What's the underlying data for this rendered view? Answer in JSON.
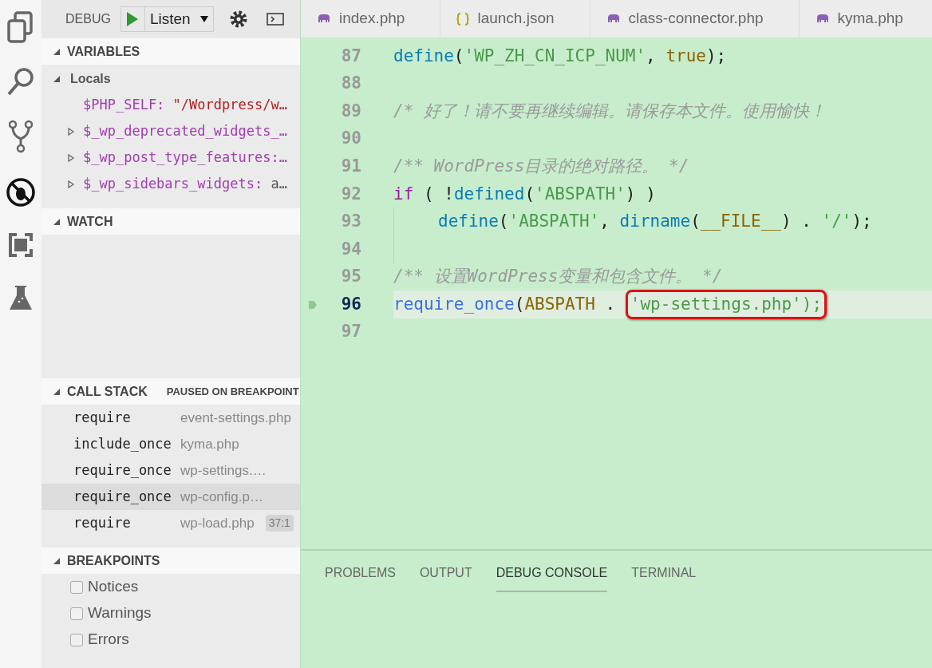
{
  "toolbar": {
    "label": "DEBUG",
    "config": "Listen"
  },
  "sections": [
    {
      "kind": "variables",
      "title": "VARIABLES",
      "expanded": true,
      "scope": {
        "label": "Locals",
        "expanded": true
      },
      "items": [
        {
          "name": "$PHP_SELF:",
          "value": " \"/Wordpress/w…",
          "kind": "string",
          "expandable": false
        },
        {
          "name": "$_wp_deprecated_widgets_…",
          "expandable": true
        },
        {
          "name": "$_wp_post_type_features:…",
          "expandable": true
        },
        {
          "name": "$_wp_sidebars_widgets:",
          "value": " a…",
          "kind": "plain",
          "expandable": true
        }
      ]
    },
    {
      "kind": "watch",
      "title": "WATCH",
      "expanded": true
    },
    {
      "kind": "callstack",
      "title": "CALL STACK",
      "status": "PAUSED ON BREAKPOINT",
      "expanded": true,
      "frames": [
        {
          "fn": "require",
          "file": "event-settings.php",
          "selected": false
        },
        {
          "fn": "include_once",
          "file": "kyma.php",
          "selected": false
        },
        {
          "fn": "require_once",
          "file": "wp-settings.…",
          "selected": false
        },
        {
          "fn": "require_once",
          "file": "wp-config.p…",
          "selected": true
        },
        {
          "fn": "require",
          "file": "wp-load.php",
          "pos": "37:1",
          "selected": false
        }
      ]
    },
    {
      "kind": "breakpoints",
      "title": "BREAKPOINTS",
      "expanded": true,
      "options": [
        {
          "label": "Notices",
          "checked": false
        },
        {
          "label": "Warnings",
          "checked": false
        },
        {
          "label": "Errors",
          "checked": false
        }
      ]
    }
  ],
  "tabs": [
    {
      "label": "index.php",
      "kind": "php",
      "selected": false
    },
    {
      "label": "launch.json",
      "kind": "json",
      "selected": false
    },
    {
      "label": "class-connector.php",
      "kind": "php",
      "selected": false
    },
    {
      "label": "kyma.php",
      "kind": "php",
      "selected": false
    }
  ],
  "code": [
    {
      "num": "87",
      "current": false,
      "indent": false,
      "tokens": [
        {
          "kind": "fn",
          "text": "define"
        },
        {
          "kind": "punct",
          "text": "("
        },
        {
          "kind": "str",
          "text": "'WP_ZH_CN_ICP_NUM'"
        },
        {
          "kind": "punct",
          "text": ", "
        },
        {
          "kind": "const",
          "text": "true"
        },
        {
          "kind": "punct",
          "text": ");"
        }
      ]
    },
    {
      "num": "88",
      "current": false,
      "indent": false
    },
    {
      "num": "89",
      "current": false,
      "indent": false,
      "tokens": [
        {
          "kind": "comment",
          "text": "/* 好了！请不要再继续编辑。请保存本文件。使用愉快！"
        }
      ]
    },
    {
      "num": "90",
      "current": false,
      "indent": false
    },
    {
      "num": "91",
      "current": false,
      "indent": false,
      "tokens": [
        {
          "kind": "comment",
          "text": "/** WordPress目录的绝对路径。 */"
        }
      ]
    },
    {
      "num": "92",
      "current": false,
      "indent": false,
      "tokens": [
        {
          "kind": "kw",
          "text": "if"
        },
        {
          "kind": "punct",
          "text": " ( !"
        },
        {
          "kind": "fn",
          "text": "defined"
        },
        {
          "kind": "punct",
          "text": "("
        },
        {
          "kind": "str",
          "text": "'ABSPATH'"
        },
        {
          "kind": "punct",
          "text": ") )"
        }
      ]
    },
    {
      "num": "93",
      "current": false,
      "indent": true,
      "tokens": [
        {
          "kind": "fn",
          "text": "define"
        },
        {
          "kind": "punct",
          "text": "("
        },
        {
          "kind": "str",
          "text": "'ABSPATH'"
        },
        {
          "kind": "punct",
          "text": ", "
        },
        {
          "kind": "fn",
          "text": "dirname"
        },
        {
          "kind": "punct",
          "text": "("
        },
        {
          "kind": "const",
          "text": "__FILE__"
        },
        {
          "kind": "punct",
          "text": ") . "
        },
        {
          "kind": "str",
          "text": "'/'"
        },
        {
          "kind": "punct",
          "text": ");"
        }
      ]
    },
    {
      "num": "94",
      "current": false,
      "indent": true
    },
    {
      "num": "95",
      "current": false,
      "indent": false,
      "tokens": [
        {
          "kind": "comment",
          "text": "/** 设置WordPress变量和包含文件。 */"
        }
      ]
    },
    {
      "num": "96",
      "current": true,
      "indent": false,
      "tokens": [
        {
          "kind": "fn2",
          "text": "require_once"
        },
        {
          "kind": "punct",
          "text": "("
        },
        {
          "kind": "const",
          "text": "ABSPATH"
        },
        {
          "kind": "punct",
          "text": " . "
        },
        {
          "kind": "marked",
          "text": "'wp-settings.php');"
        }
      ]
    },
    {
      "num": "97",
      "current": false,
      "indent": false
    }
  ],
  "panel_tabs": [
    {
      "label": "PROBLEMS",
      "selected": false
    },
    {
      "label": "OUTPUT",
      "selected": false
    },
    {
      "label": "DEBUG CONSOLE",
      "selected": true
    },
    {
      "label": "TERMINAL",
      "selected": false
    }
  ]
}
